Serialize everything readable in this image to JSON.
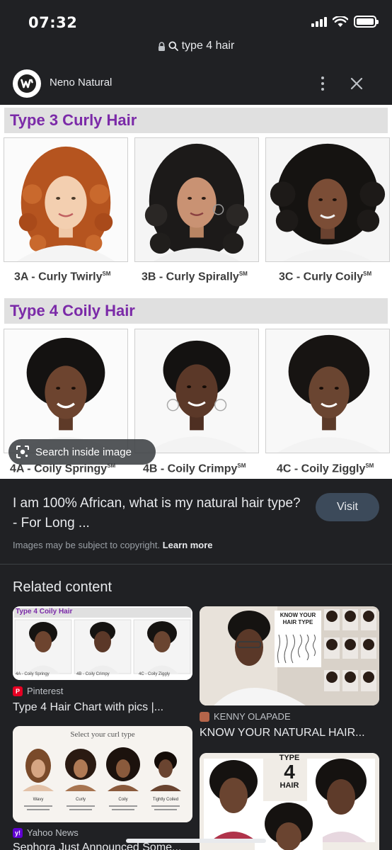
{
  "status_bar": {
    "time": "07:32"
  },
  "url_bar": {
    "query": "type 4 hair",
    "lock_icon": "lock-icon",
    "search_icon": "search-icon"
  },
  "source": {
    "name": "Neno Natural",
    "logo_letter": "w"
  },
  "main_image": {
    "section1_title": "Type 3 Curly Hair",
    "section2_title": "Type 4 Coily Hair",
    "captions": {
      "c3a": "3A - Curly Twirly",
      "c3b": "3B - Curly Spirally",
      "c3c": "3C - Curly Coily",
      "c4a": "4A - Coily Springy",
      "c4b": "4B - Coily Crimpy",
      "c4c": "4C - Coily Ziggly",
      "mark": "SM"
    },
    "search_inside_label": "Search inside image"
  },
  "result": {
    "title": "I am 100% African, what is my natural hair type? - For Long ...",
    "visit_label": "Visit",
    "copyright_text": "Images may be subject to copyright.",
    "learn_more": "Learn more"
  },
  "related": {
    "heading": "Related content",
    "cards": [
      {
        "source": "Pinterest",
        "title": "Type 4 Hair Chart with pics |...",
        "image_title": "Type 4 Coily Hair",
        "image_captions": [
          "4A - Coily Springy",
          "4B - Coily Crimpy",
          "4C - Coily Ziggly"
        ]
      },
      {
        "source": "KENNY OLAPADE",
        "title": "KNOW YOUR NATURAL HAIR...",
        "image_text": "KNOW YOUR HAIR TYPE"
      },
      {
        "source": "Yahoo News",
        "title": "Sephora Just Announced Some...",
        "image_title": "Select your curl type",
        "image_labels": [
          "Wavy",
          "Curly",
          "Coily",
          "Tightly Coiled"
        ]
      },
      {
        "source": "",
        "title": "",
        "image_text_lines": [
          "TYPE",
          "4",
          "HAIR"
        ]
      }
    ]
  },
  "colors": {
    "accent_purple": "#7b2aa8",
    "background": "#202124",
    "visit_button": "#3c4a5a"
  }
}
